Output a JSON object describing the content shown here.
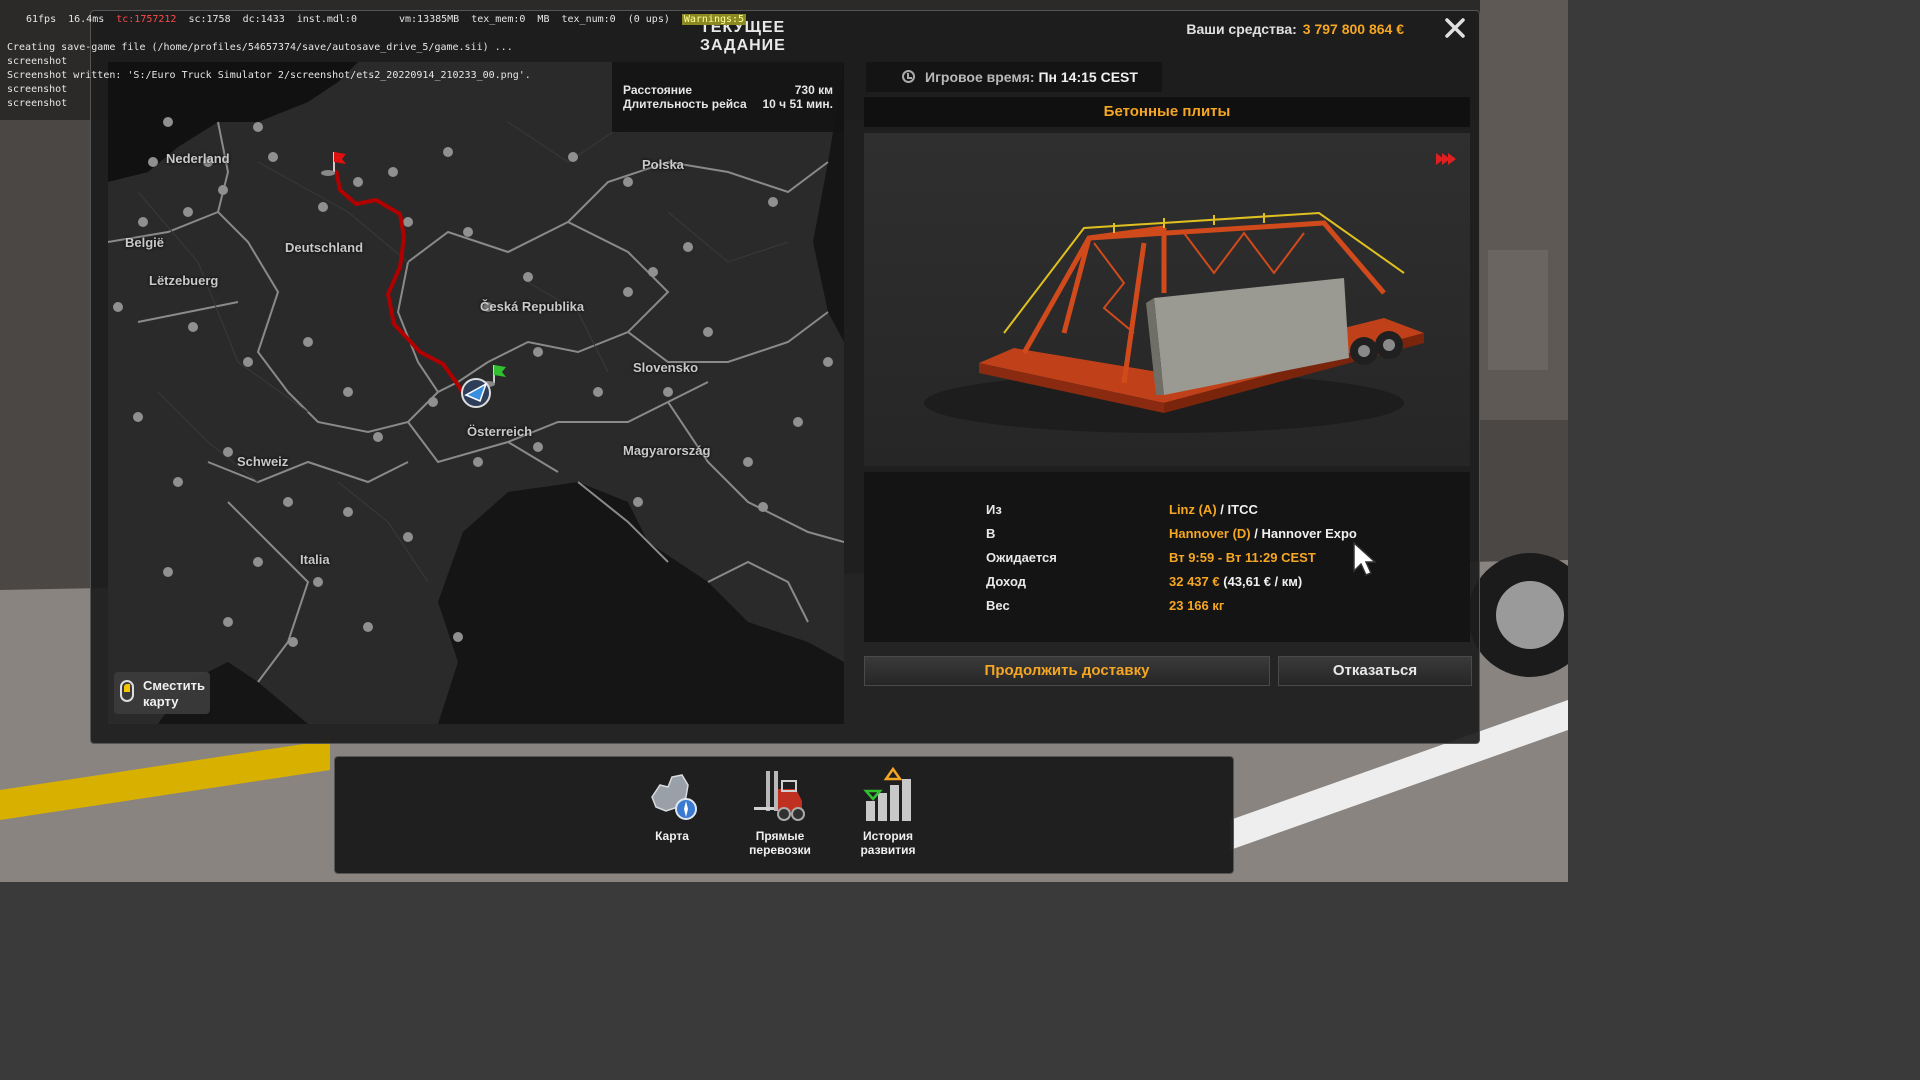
{
  "debug": {
    "fps": "61fps",
    "frametime": "16.4ms",
    "tc": "tc:1757212",
    "sc": "sc:1758",
    "dc": "dc:1433",
    "inst": "inst.mdl:0",
    "vm": "vm:13385MB",
    "tex_mem": "tex_mem:0  MB",
    "tex_num": "tex_num:0  (0 ups)",
    "warnings": "Warnings:5",
    "log": [
      "Creating save-game file (/home/profiles/54657374/save/autosave_drive_5/game.sii) ...",
      "screenshot",
      "Screenshot written: 'S:/Euro Truck Simulator 2/screenshot/ets2_20220914_210233_00.png'.",
      "screenshot",
      "screenshot"
    ]
  },
  "window": {
    "title": "ТЕКУЩЕЕ ЗАДАНИЕ",
    "funds_label": "Ваши средства:",
    "funds_value": "3 797 800 864 €",
    "close_icon": "close-icon"
  },
  "map": {
    "countries": [
      {
        "id": "nl",
        "name": "Nederland"
      },
      {
        "id": "be",
        "name": "België"
      },
      {
        "id": "lu",
        "name": "Lëtzebuerg"
      },
      {
        "id": "de",
        "name": "Deutschland"
      },
      {
        "id": "pl",
        "name": "Polska"
      },
      {
        "id": "cz",
        "name": "Česká Republika"
      },
      {
        "id": "sk",
        "name": "Slovensko"
      },
      {
        "id": "at",
        "name": "Österreich"
      },
      {
        "id": "hu",
        "name": "Magyarország"
      },
      {
        "id": "ch",
        "name": "Schweiz"
      },
      {
        "id": "it",
        "name": "Italia"
      }
    ],
    "route_color": "#b00000",
    "distance_label": "Расстояние",
    "distance_value": "730 км",
    "duration_label": "Длительность рейса",
    "duration_value": "10 ч 51 мин.",
    "move_map_label": "Сместить карту",
    "move_map_icon": "mouse-icon"
  },
  "game_time": {
    "label": "Игровое время:",
    "value": "Пн 14:15 CEST",
    "icon": "clock-icon"
  },
  "cargo": {
    "name": "Бетонные плиты",
    "urgency_icon": "fast-forward-icon"
  },
  "details": {
    "from_label": "Из",
    "from_city": "Linz (A)",
    "from_company": "ITCC",
    "to_label": "В",
    "to_city": "Hannover (D)",
    "to_company": "Hannover Expo",
    "expected_label": "Ожидается",
    "expected_value": "Вт 9:59 - Вт 11:29 CEST",
    "income_label": "Доход",
    "income_value": "32 437 €",
    "income_rate": "(43,61 € / км)",
    "weight_label": "Вес",
    "weight_value": "23 166 кг",
    "separator": "/"
  },
  "buttons": {
    "continue": "Продолжить доставку",
    "cancel": "Отказаться"
  },
  "dock": {
    "items": [
      {
        "label": "Карта",
        "icon": "europe-map-icon"
      },
      {
        "label_1": "Прямые",
        "label_2": "перевозки",
        "icon": "forklift-icon"
      },
      {
        "label_1": "История",
        "label_2": "развития",
        "icon": "progress-bars-icon"
      }
    ]
  },
  "colors": {
    "accent": "#f5a623",
    "route": "#b00000",
    "window_bg": "#1c1c1c"
  }
}
